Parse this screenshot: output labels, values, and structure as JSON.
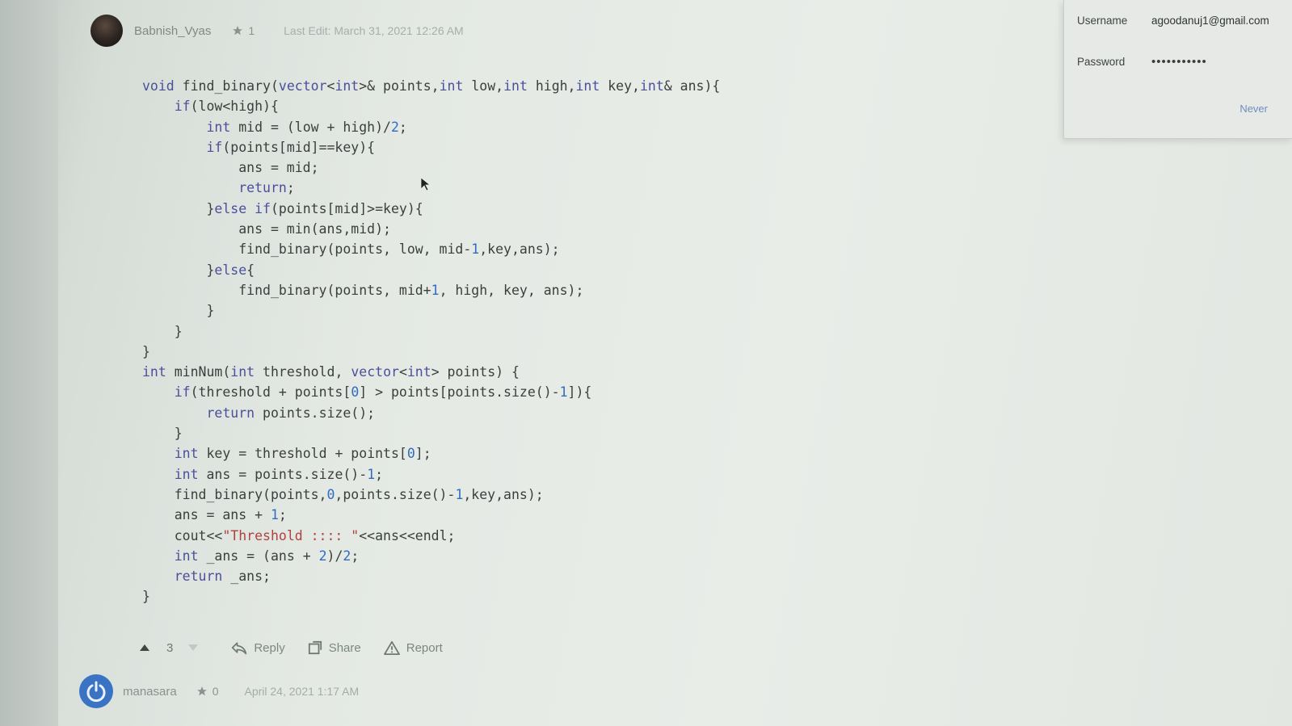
{
  "post": {
    "author": "Babnish_Vyas",
    "star_count": "1",
    "last_edit": "Last Edit: March 31, 2021 12:26 AM",
    "code_lines": [
      "void find_binary(vector<int>& points,int low,int high,int key,int& ans){",
      "    if(low<high){",
      "        int mid = (low + high)/2;",
      "        if(points[mid]==key){",
      "            ans = mid;",
      "            return;",
      "        }else if(points[mid]>=key){",
      "            ans = min(ans,mid);",
      "            find_binary(points, low, mid-1,key,ans);",
      "        }else{",
      "            find_binary(points, mid+1, high, key, ans);",
      "        }",
      "    }",
      "}",
      "int minNum(int threshold, vector<int> points) {",
      "    if(threshold + points[0] > points[points.size()-1]){",
      "        return points.size();",
      "    }",
      "    int key = threshold + points[0];",
      "    int ans = points.size()-1;",
      "    find_binary(points,0,points.size()-1,key,ans);",
      "    ans = ans + 1;",
      "    cout<<\"Threshold :::: \"<<ans<<endl;",
      "    int _ans = (ans + 2)/2;",
      "    return _ans;",
      "}"
    ],
    "vote_count": "3",
    "reply_label": "Reply",
    "share_label": "Share",
    "report_label": "Report"
  },
  "comment2": {
    "author": "manasara",
    "star_count": "0",
    "time": "April 24, 2021 1:17 AM"
  },
  "password_popup": {
    "username_label": "Username",
    "username_value": "agoodanuj1@gmail.com",
    "password_label": "Password",
    "password_value": "•••••••••••",
    "never_label": "Never"
  },
  "colors": {
    "keyword": "#4b4f9a",
    "number": "#2f6cc0",
    "string": "#b0413e",
    "avatar2": "#3a73c4"
  },
  "icons": [
    "star-icon",
    "upvote-icon",
    "downvote-icon",
    "reply-icon",
    "share-icon",
    "report-icon",
    "power-avatar-icon",
    "mouse-cursor-icon"
  ]
}
